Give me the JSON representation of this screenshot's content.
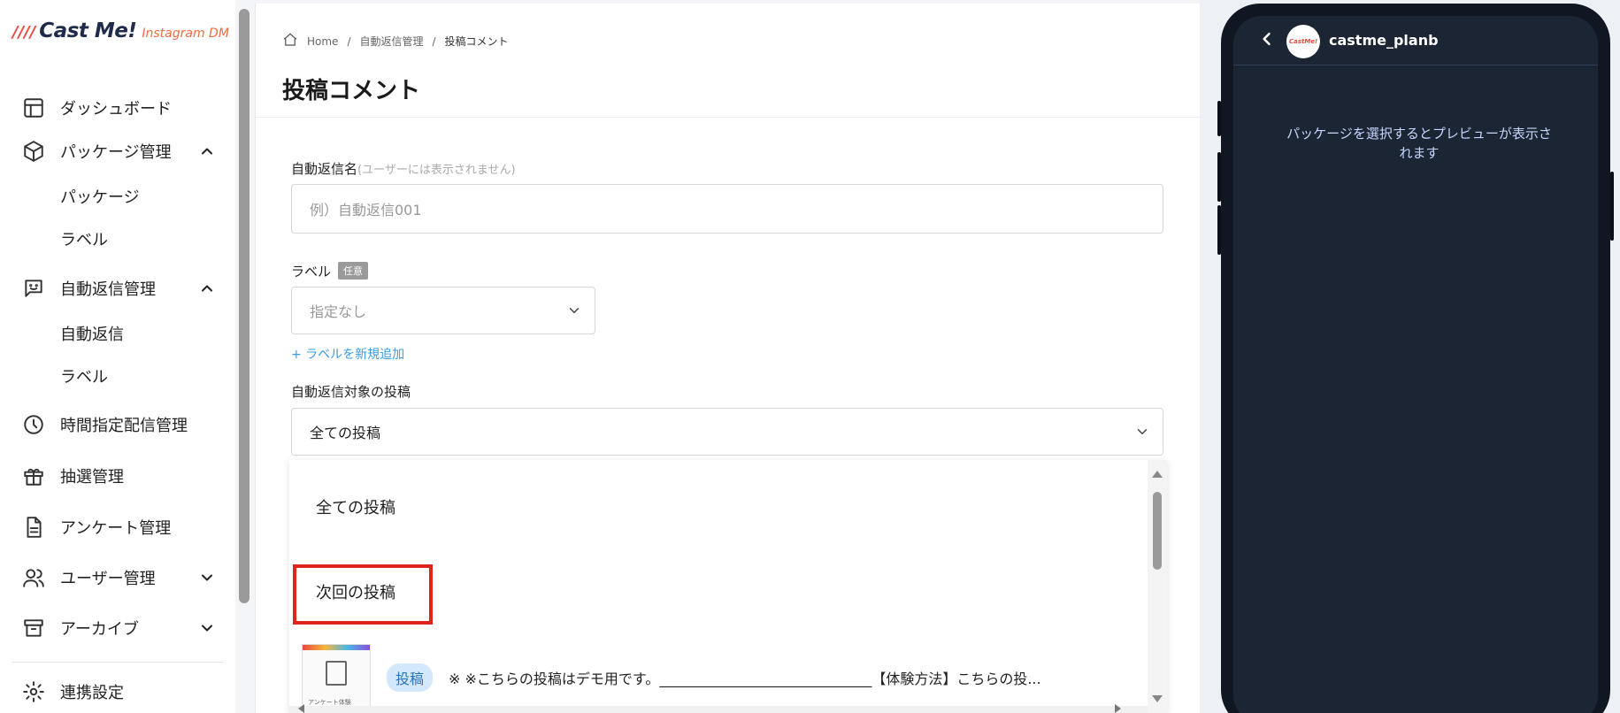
{
  "brand": {
    "mark": "////",
    "name": "Cast Me!",
    "sub": "Instagram DM"
  },
  "sidebar": {
    "items": [
      {
        "label": "ダッシュボード"
      },
      {
        "label": "パッケージ管理"
      },
      {
        "label": "自動返信管理"
      },
      {
        "label": "時間指定配信管理"
      },
      {
        "label": "抽選管理"
      },
      {
        "label": "アンケート管理"
      },
      {
        "label": "ユーザー管理"
      },
      {
        "label": "アーカイブ"
      },
      {
        "label": "連携設定"
      }
    ],
    "package_sub": [
      "パッケージ",
      "ラベル"
    ],
    "autoreply_sub": [
      "自動返信",
      "ラベル"
    ]
  },
  "breadcrumb": {
    "home": "Home",
    "level2": "自動返信管理",
    "current": "投稿コメント"
  },
  "page": {
    "title": "投稿コメント"
  },
  "form": {
    "name_label": "自動返信名",
    "name_note": "(ユーザーには表示されません)",
    "name_placeholder": "例）自動返信001",
    "label_label": "ラベル",
    "label_badge": "任意",
    "label_value": "指定なし",
    "add_label_link": "+ ラベルを新規追加",
    "target_label": "自動返信対象の投稿",
    "target_value": "全ての投稿"
  },
  "dropdown": {
    "options": [
      "全ての投稿",
      "次回の投稿"
    ],
    "post_tag": "投稿",
    "post_text": "※ ※こちらの投稿はデモ用です。______________________________【体験方法】こちらの投...",
    "thumb_caption": "アンケート体験"
  },
  "preview": {
    "account": "castme_planb",
    "avatar_text": "CastMe!",
    "message": "パッケージを選択するとプレビューが表示されます"
  },
  "colors": {
    "accent": "#3c9ce0",
    "highlight": "#e0241f",
    "phone_bg": "#1c2534"
  }
}
